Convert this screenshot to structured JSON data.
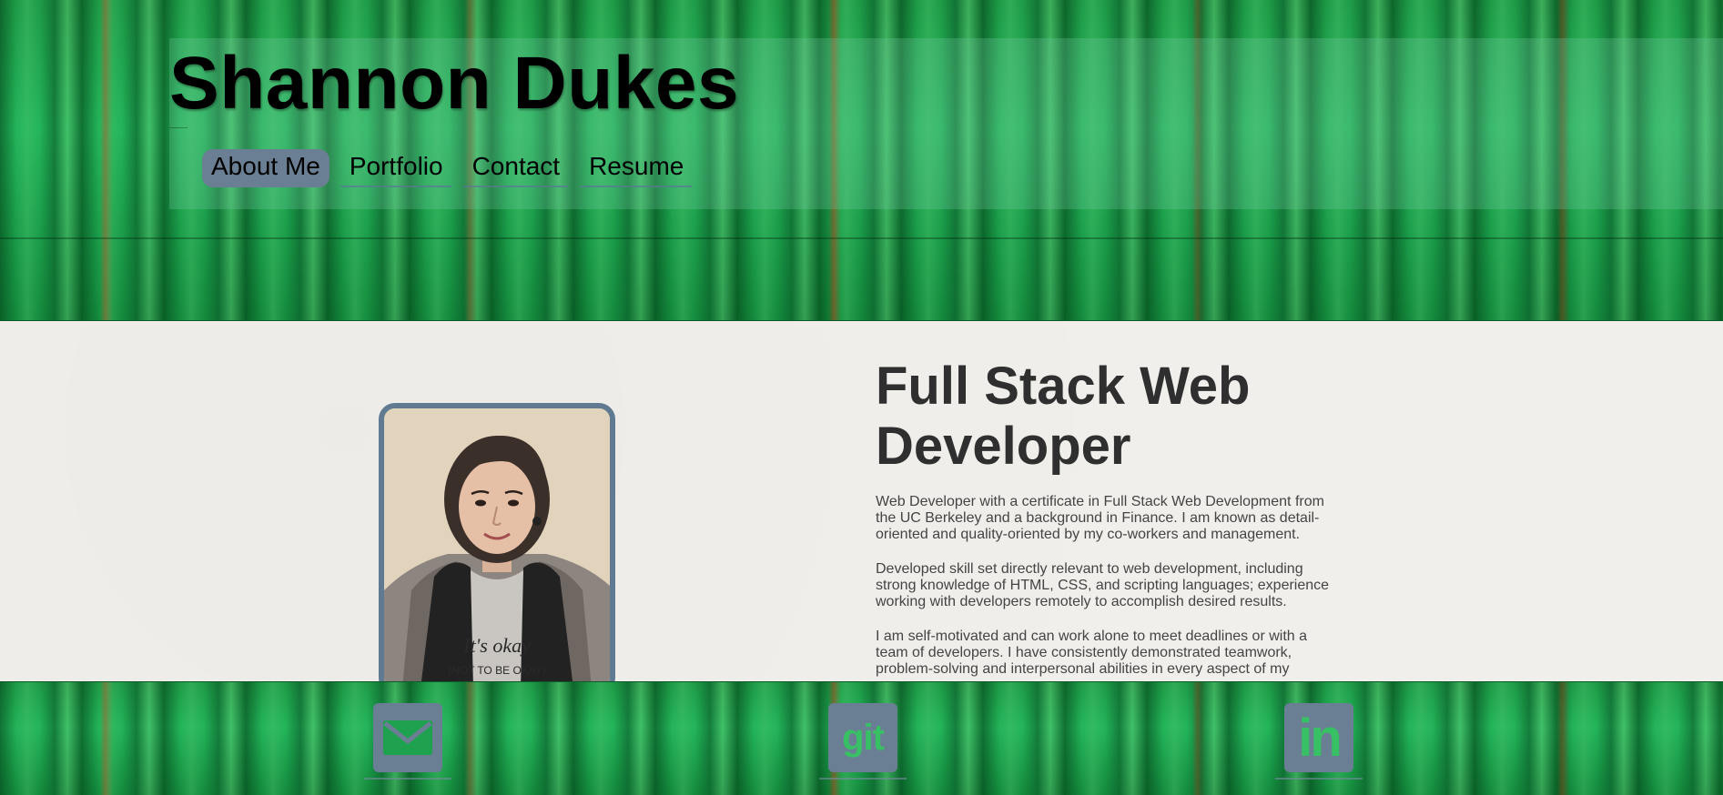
{
  "header": {
    "site_title": "Shannon Dukes",
    "nav": [
      {
        "label": "About Me",
        "active": true
      },
      {
        "label": "Portfolio",
        "active": false
      },
      {
        "label": "Contact",
        "active": false
      },
      {
        "label": "Resume",
        "active": false
      }
    ]
  },
  "main": {
    "headline": "Full Stack Web Developer",
    "portrait": {
      "icon": "profile-photo",
      "shirt_text": "It's okay (NOT TO BE OKAY)"
    },
    "bio": [
      "Web Developer with a certificate in Full Stack Web Development from the UC Berkeley and a background in Finance. I am known as detail-oriented and quality-oriented by my co-workers and management.",
      "Developed skill set directly relevant to web development, including strong knowledge of HTML, CSS, and scripting languages; experience working with developers remotely to accomplish desired results.",
      "I am self-motivated and can work alone to meet deadlines or with a team of developers. I have consistently demonstrated teamwork, problem-solving and interpersonal abilities in every aspect of my"
    ]
  },
  "footer": {
    "links": [
      {
        "icon": "envelope-icon"
      },
      {
        "icon": "git-icon",
        "label": "git"
      },
      {
        "icon": "linkedin-icon",
        "label": "in"
      }
    ]
  },
  "colors": {
    "accent": "#6a7f93",
    "green": "#1ea24f",
    "page_bg": "#f1efeb",
    "text_dark": "#2f2f2f"
  }
}
